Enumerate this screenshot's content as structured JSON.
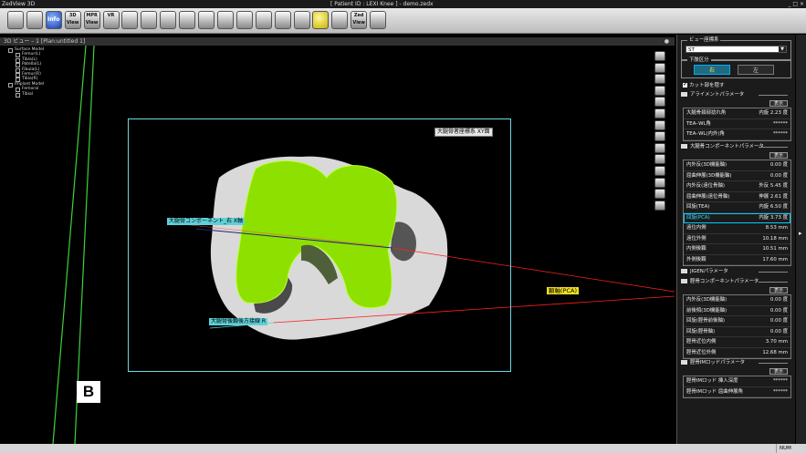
{
  "titlebar": {
    "app": "ZedView 3D",
    "document": "[ Patient ID : LEXI Knee ]  - demo.zedx",
    "window_buttons": "_ □ ×"
  },
  "toolbar": {
    "buttons": [
      {
        "name": "db-button",
        "label": ""
      },
      {
        "name": "db2-button",
        "label": ""
      },
      {
        "name": "info-button",
        "label": "Info"
      },
      {
        "name": "3d-view-button",
        "label": "3D View"
      },
      {
        "name": "mpr-view-button",
        "label": "MPR View"
      },
      {
        "name": "vr-button",
        "label": "VR"
      },
      {
        "name": "tool-7-button",
        "label": ""
      },
      {
        "name": "tool-8-button",
        "label": ""
      },
      {
        "name": "tool-9-button",
        "label": ""
      },
      {
        "name": "tool-10-button",
        "label": ""
      },
      {
        "name": "tool-11-button",
        "label": ""
      },
      {
        "name": "tool-12-button",
        "label": ""
      },
      {
        "name": "tool-13-button",
        "label": ""
      },
      {
        "name": "tool-14-button",
        "label": ""
      },
      {
        "name": "tool-15-button",
        "label": ""
      },
      {
        "name": "tool-16-button",
        "label": ""
      },
      {
        "name": "tool-17-button",
        "label": ""
      },
      {
        "name": "tool-18-button",
        "label": ""
      },
      {
        "name": "zed-view-button",
        "label": "Zed View"
      },
      {
        "name": "tool-20-button",
        "label": ""
      }
    ]
  },
  "viewport": {
    "header": "3D ビュー – 1 [Plan:untitled 1]",
    "close": "●",
    "tree": [
      {
        "label": "Surface Model",
        "level": 1
      },
      {
        "label": "Femur(L)",
        "level": 2
      },
      {
        "label": "Tibia(L)",
        "level": 2
      },
      {
        "label": "Patella(L)",
        "level": 2
      },
      {
        "label": "Fibula(L)",
        "level": 2
      },
      {
        "label": "Femur(R)",
        "level": 2
      },
      {
        "label": "Tibia(R)",
        "level": 2
      },
      {
        "label": "Implant Model",
        "level": 1
      },
      {
        "label": "Femoral",
        "level": 2
      },
      {
        "label": "Tibial",
        "level": 2
      }
    ],
    "labels": {
      "femur_axis": "大腿骨者座標系 XY面",
      "component": "大腿骨コンポーネント_右 X軸",
      "posterior": "大腿骨後顆後方接線 R",
      "pca": "顆軸(PCA)"
    },
    "mark": "B"
  },
  "panel": {
    "view_group": {
      "label": "ビュー座標系",
      "selected": "ST"
    },
    "side_group": {
      "label": "下肢区分",
      "right": "右",
      "left": "左"
    },
    "cut_checkbox": {
      "label": "カット部を隠す",
      "checked": "✔"
    },
    "display_label": "表示",
    "alignment": {
      "title": "アライメントパラメータ",
      "rows": [
        {
          "k": "大腿骨頚部捻れ角",
          "v": "内旋 2.23 度"
        },
        {
          "k": "TEA–WL角",
          "v": "******"
        },
        {
          "k": "TEA–WL(内外)角",
          "v": "******"
        }
      ]
    },
    "femoral": {
      "title": "大腿骨コンポーネントパラメータ",
      "rows": [
        {
          "k": "内外反(3D機能軸)",
          "v": "0.00 度"
        },
        {
          "k": "屈曲伸展(3D機能軸)",
          "v": "0.00 度"
        },
        {
          "k": "内外反(遠位骨軸)",
          "v": "外反 5.45 度"
        },
        {
          "k": "屈曲伸展(遠位骨軸)",
          "v": "伸展 2.61 度"
        },
        {
          "k": "回旋(TEA)",
          "v": "内旋 6.50 度"
        },
        {
          "k": "回旋(PCA)",
          "v": "内旋 3.73 度"
        },
        {
          "k": "遠位内側",
          "v": "8.53 mm"
        },
        {
          "k": "遠位外側",
          "v": "10.18 mm"
        },
        {
          "k": "内側後顆",
          "v": "10.51 mm"
        },
        {
          "k": "外側後顆",
          "v": "17.60 mm"
        }
      ]
    },
    "jigen": {
      "title": "JIGENパラメータ"
    },
    "tibial": {
      "title": "脛骨コンポーネントパラメータ",
      "rows": [
        {
          "k": "内外反(3D機能軸)",
          "v": "0.00 度"
        },
        {
          "k": "前後傾(3D機能軸)",
          "v": "0.00 度"
        },
        {
          "k": "回旋(脛骨前後軸)",
          "v": "0.00 度"
        },
        {
          "k": "回旋(脛骨軸)",
          "v": "0.00 度"
        },
        {
          "k": "脛骨近位内側",
          "v": "3.70 mm"
        },
        {
          "k": "脛骨近位外側",
          "v": "12.68 mm"
        }
      ]
    },
    "rod": {
      "title": "脛骨IMロッドパラメータ",
      "rows": [
        {
          "k": "脛骨IMロッド 挿入深度",
          "v": "******"
        },
        {
          "k": "脛骨IMロッド 屈曲伸展角",
          "v": "******"
        }
      ]
    }
  },
  "statusbar": {
    "num": "NUM"
  },
  "colors": {
    "implant": "#8ee000",
    "bone": "#d4d4d4",
    "cyan": "#5fd0d8",
    "highlight": "#3fd8ff"
  }
}
